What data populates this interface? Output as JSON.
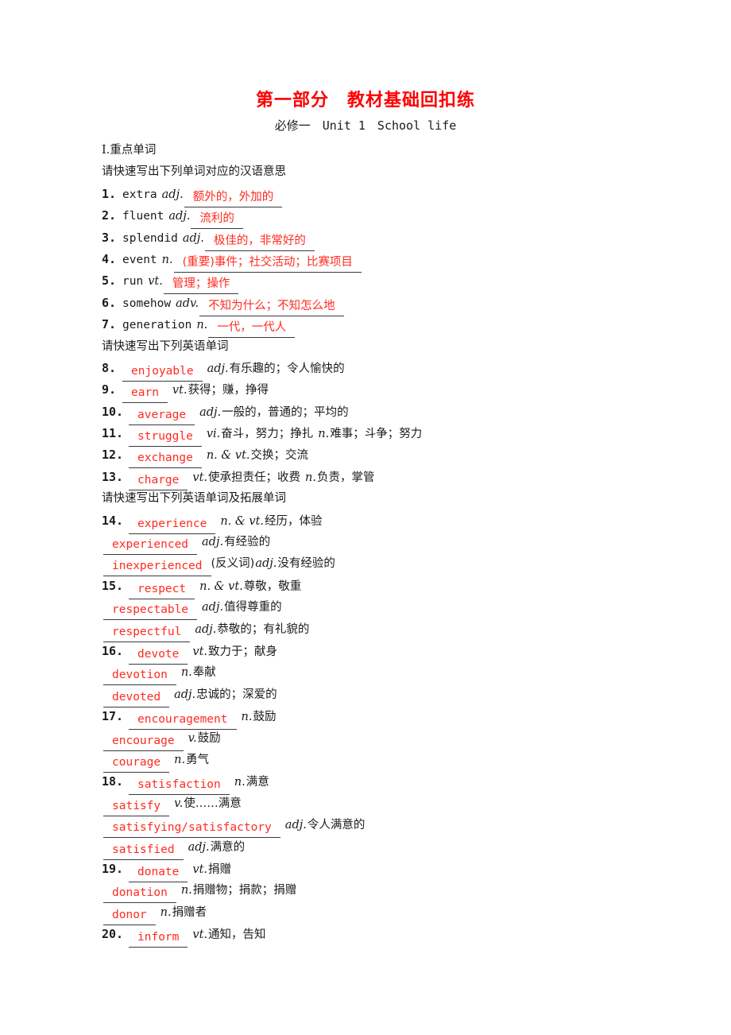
{
  "header": {
    "title": "第一部分　教材基础回扣练",
    "subtitle": "必修一　Unit 1　School life",
    "title_color": "#ff0000"
  },
  "answer_color": "#ff2a20",
  "section": {
    "roman": "Ⅰ",
    "heading": ".重点单词",
    "prompt_cn_meaning": "请快速写出下列单词对应的汉语意思",
    "prompt_en_word": "请快速写出下列英语单词",
    "prompt_en_extend": "请快速写出下列英语单词及拓展单词"
  },
  "group_cn": [
    {
      "num": "1.",
      "word": "extra",
      "pos": "adj.",
      "answer": "额外的，外加的"
    },
    {
      "num": "2.",
      "word": "fluent",
      "pos": "adj.",
      "answer": "流利的"
    },
    {
      "num": "3.",
      "word": "splendid",
      "pos": "adj.",
      "answer": "极佳的，非常好的"
    },
    {
      "num": "4.",
      "word": "event",
      "pos": "n.",
      "answer": "(重要)事件；社交活动；比赛项目"
    },
    {
      "num": "5.",
      "word": "run",
      "pos": "vt.",
      "answer": "管理；操作"
    },
    {
      "num": "6.",
      "word": "somehow",
      "pos": "adv.",
      "answer": "不知为什么；不知怎么地"
    },
    {
      "num": "7.",
      "word": "generation",
      "pos": "n.",
      "answer": "一代，一代人"
    }
  ],
  "group_en": [
    {
      "num": "8.",
      "answer": "enjoyable",
      "pos": "adj.",
      "gloss": "有乐趣的；令人愉快的"
    },
    {
      "num": "9.",
      "answer": "earn",
      "pos": "vt.",
      "gloss": "获得；赚，挣得"
    },
    {
      "num": "10.",
      "answer": "average",
      "pos": "adj.",
      "gloss": "一般的，普通的；平均的"
    },
    {
      "num": "11.",
      "answer": "struggle",
      "pos": "vi.",
      "gloss": "奋斗，努力；挣扎",
      "pos2": "n.",
      "gloss2": "难事；斗争；努力"
    },
    {
      "num": "12.",
      "answer": "exchange",
      "pos": "n. & vt.",
      "gloss": "交换；交流"
    },
    {
      "num": "13.",
      "answer": "charge",
      "pos": "vt.",
      "gloss": "使承担责任；收费",
      "pos2": "n.",
      "gloss2": "负责，掌管"
    }
  ],
  "group_extend": [
    {
      "num": "14.",
      "answer": "experience",
      "pos": "n. & vt.",
      "gloss": "经历，体验"
    },
    {
      "num": "",
      "answer": "experienced",
      "pos": "adj.",
      "gloss": "有经验的"
    },
    {
      "num": "",
      "answer": "inexperienced",
      "note": "(反义词)",
      "pos": "adj.",
      "gloss": "没有经验的"
    },
    {
      "num": "15.",
      "answer": "respect",
      "pos": "n. & vt.",
      "gloss": "尊敬，敬重"
    },
    {
      "num": "",
      "answer": "respectable",
      "pos": "adj.",
      "gloss": "值得尊重的"
    },
    {
      "num": "",
      "answer": "respectful",
      "pos": "adj.",
      "gloss": "恭敬的；有礼貌的"
    },
    {
      "num": "16.",
      "answer": "devote",
      "pos": "vt.",
      "gloss": "致力于；献身"
    },
    {
      "num": "",
      "answer": "devotion",
      "pos": "n.",
      "gloss": "奉献"
    },
    {
      "num": "",
      "answer": "devoted",
      "pos": "adj.",
      "gloss": "忠诚的；深爱的"
    },
    {
      "num": "17.",
      "answer": "encouragement",
      "pos": "n.",
      "gloss": "鼓励"
    },
    {
      "num": "",
      "answer": "encourage",
      "pos": "v.",
      "gloss": "鼓励"
    },
    {
      "num": "",
      "answer": "courage",
      "pos": "n.",
      "gloss": "勇气"
    },
    {
      "num": "18.",
      "answer": "satisfaction",
      "pos": "n.",
      "gloss": "满意"
    },
    {
      "num": "",
      "answer": "satisfy",
      "pos": "v.",
      "gloss": "使……满意"
    },
    {
      "num": "",
      "answer": "satisfying/satisfactory",
      "pos": "adj.",
      "gloss": "令人满意的"
    },
    {
      "num": "",
      "answer": "satisfied",
      "pos": "adj.",
      "gloss": "满意的"
    },
    {
      "num": "19.",
      "answer": "donate",
      "pos": "vt.",
      "gloss": "捐赠"
    },
    {
      "num": "",
      "answer": "donation",
      "pos": "n.",
      "gloss": "捐赠物；捐款；捐赠"
    },
    {
      "num": "",
      "answer": "donor",
      "pos": "n.",
      "gloss": "捐赠者"
    },
    {
      "num": "20.",
      "answer": "inform",
      "pos": "vt.",
      "gloss": "通知，告知"
    }
  ]
}
